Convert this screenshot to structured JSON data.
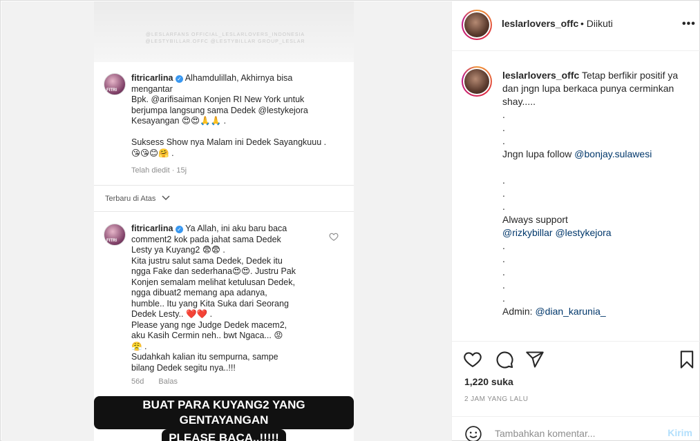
{
  "post_image": {
    "watermark": "@LESLARFANS OFFICIAL_LESLARLOVERS_INDONESIA @LESTYBILLAR.OFFC @LESTYBILLAR GROUP_LESLAR",
    "comment1": {
      "avatar_label": "FITRI",
      "username": "fitricarlina",
      "line1": "Alhamdulillah, Akhirnya bisa",
      "line2": "mengantar",
      "line3": "Bpk. @arifisaiman Konjen RI New York untuk",
      "line4": "berjumpa langsung sama Dedek @lestykejora",
      "line5": "Kesayangan 😍😍🙏🙏 .",
      "line6": "Suksess Show nya Malam ini Dedek Sayangkuuu .",
      "line7": "😘😘😊🤗 .",
      "meta": "Telah diedit · 15j"
    },
    "sort_label": "Terbaru di Atas",
    "comment2": {
      "avatar_label": "FITRI",
      "username": "fitricarlina",
      "line1": "Ya Allah, ini aku baru baca",
      "line2": "comment2 kok pada jahat sama Dedek",
      "line3": "Lesty ya Kuyang2 😨😨 .",
      "line4": "Kita justru salut sama Dedek, Dedek itu",
      "line5": "ngga Fake dan sederhana😍😍. Justru Pak",
      "line6": "Konjen semalam melihat ketulusan Dedek,",
      "line7": "ngga dibuat2 memang apa adanya,",
      "line8": "humble.. Itu yang Kita Suka dari Seorang",
      "line9": "Dedek Lesty.. ❤️❤️ .",
      "line10": "Please yang nge Judge Dedek macem2,",
      "line11": "aku Kasih Cermin neh.. bwt Ngaca... 😡",
      "line12": "😤 .",
      "line13": "Sudahkah kalian itu sempurna, sampe",
      "line14": "bilang Dedek segitu nya..!!!",
      "meta_time": "56d",
      "meta_reply": "Balas"
    },
    "banner_line1": "BUAT PARA KUYANG2 YANG GENTAYANGAN",
    "banner_line2": "PLEASE BACA..!!!!!"
  },
  "header": {
    "username": "leslarlovers_offc",
    "follow_status": "• Diikuti",
    "more_icon": "more-horizontal-icon"
  },
  "caption": {
    "username": "leslarlovers_offc",
    "text1": "Tetap berfikir positif ya dan jngn lupa berkaca punya cerminkan shay.....",
    "dot": ".",
    "follow_text": "Jngn lupa follow ",
    "follow_mention": "@bonjay.sulawesi",
    "support_text": "Always support",
    "mention1": "@rizkybillar",
    "mention2": "@lestykejora",
    "admin_text": "Admin: ",
    "admin_mention": "@dian_karunia_"
  },
  "actions": {
    "likes": "1,220 suka",
    "time": "2 JAM YANG LALU",
    "comment_placeholder": "Tambahkan komentar...",
    "post_label": "Kirim"
  },
  "colors": {
    "mention": "#00376b",
    "post_button_disabled": "#b2dffc",
    "verified": "#3897f0"
  }
}
